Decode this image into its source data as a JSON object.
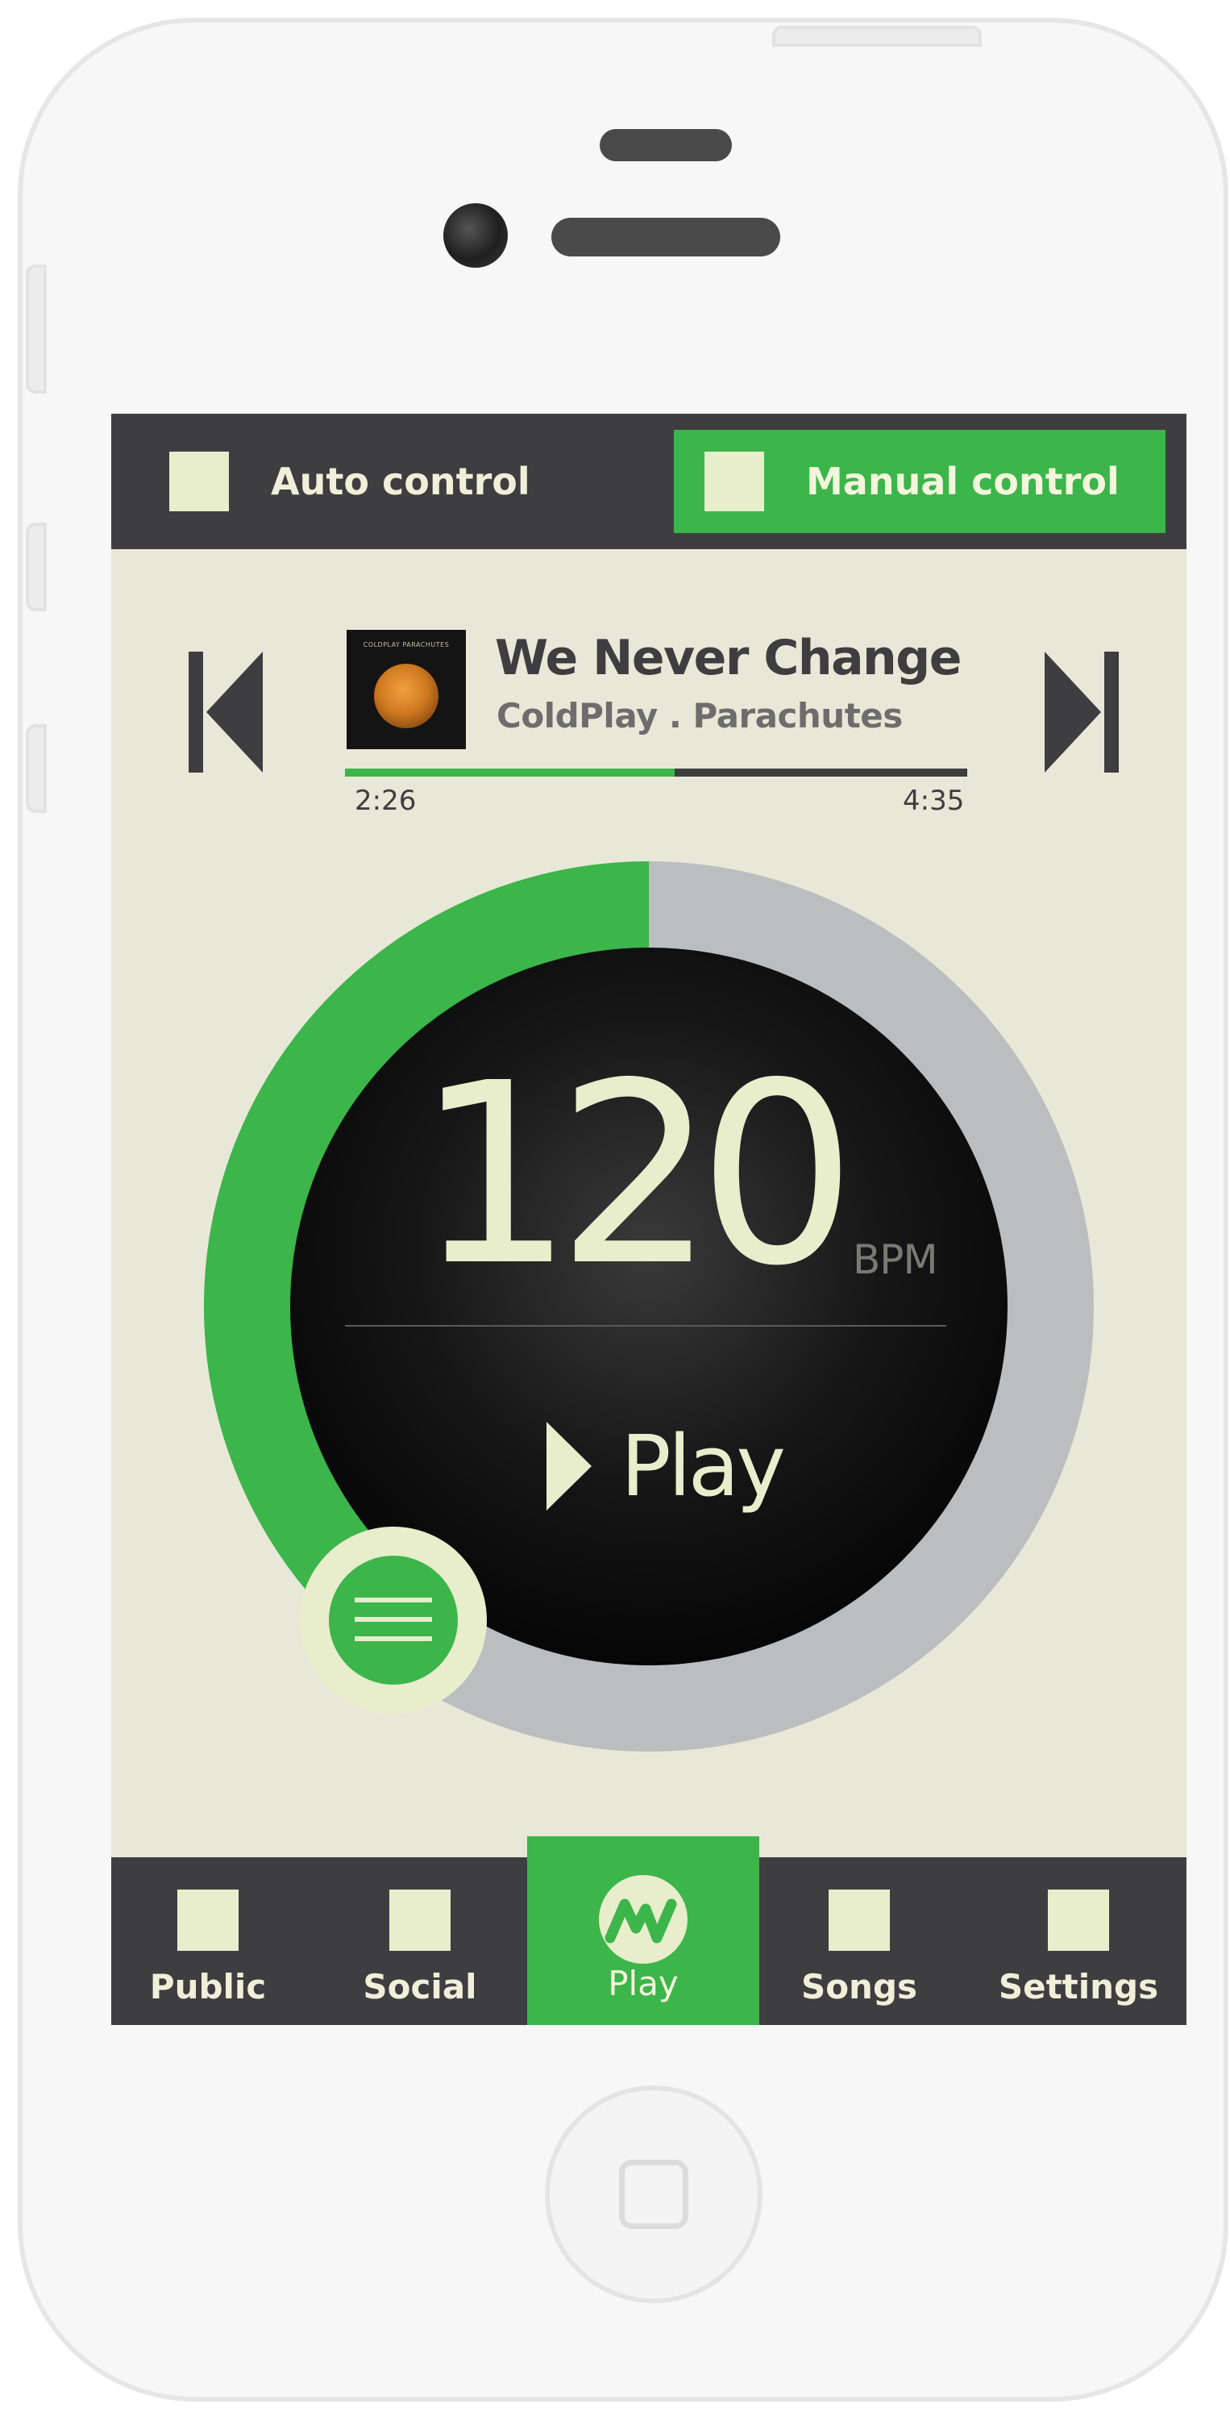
{
  "controls": {
    "auto_label": "Auto control",
    "manual_label": "Manual control",
    "selected": "manual"
  },
  "track": {
    "title": "We Never Change",
    "subtitle": "ColdPlay . Parachutes",
    "album_art_text": "COLDPLAY PARACHUTES",
    "elapsed": "2:26",
    "total": "4:35",
    "progress_fraction": 0.53
  },
  "dial": {
    "bpm": "120",
    "unit": "BPM",
    "play_label": "Play",
    "level_fraction": 0.4
  },
  "nav": {
    "items": [
      {
        "label": "Public"
      },
      {
        "label": "Social"
      },
      {
        "label": "Play"
      },
      {
        "label": "Songs"
      },
      {
        "label": "Settings"
      }
    ],
    "active": "Play"
  },
  "colors": {
    "accent": "#3cb54a",
    "dark": "#3e3e40",
    "screen_bg": "#e8e8d8",
    "cream": "#e8edcc",
    "ring_bg": "#bcbdbf"
  }
}
